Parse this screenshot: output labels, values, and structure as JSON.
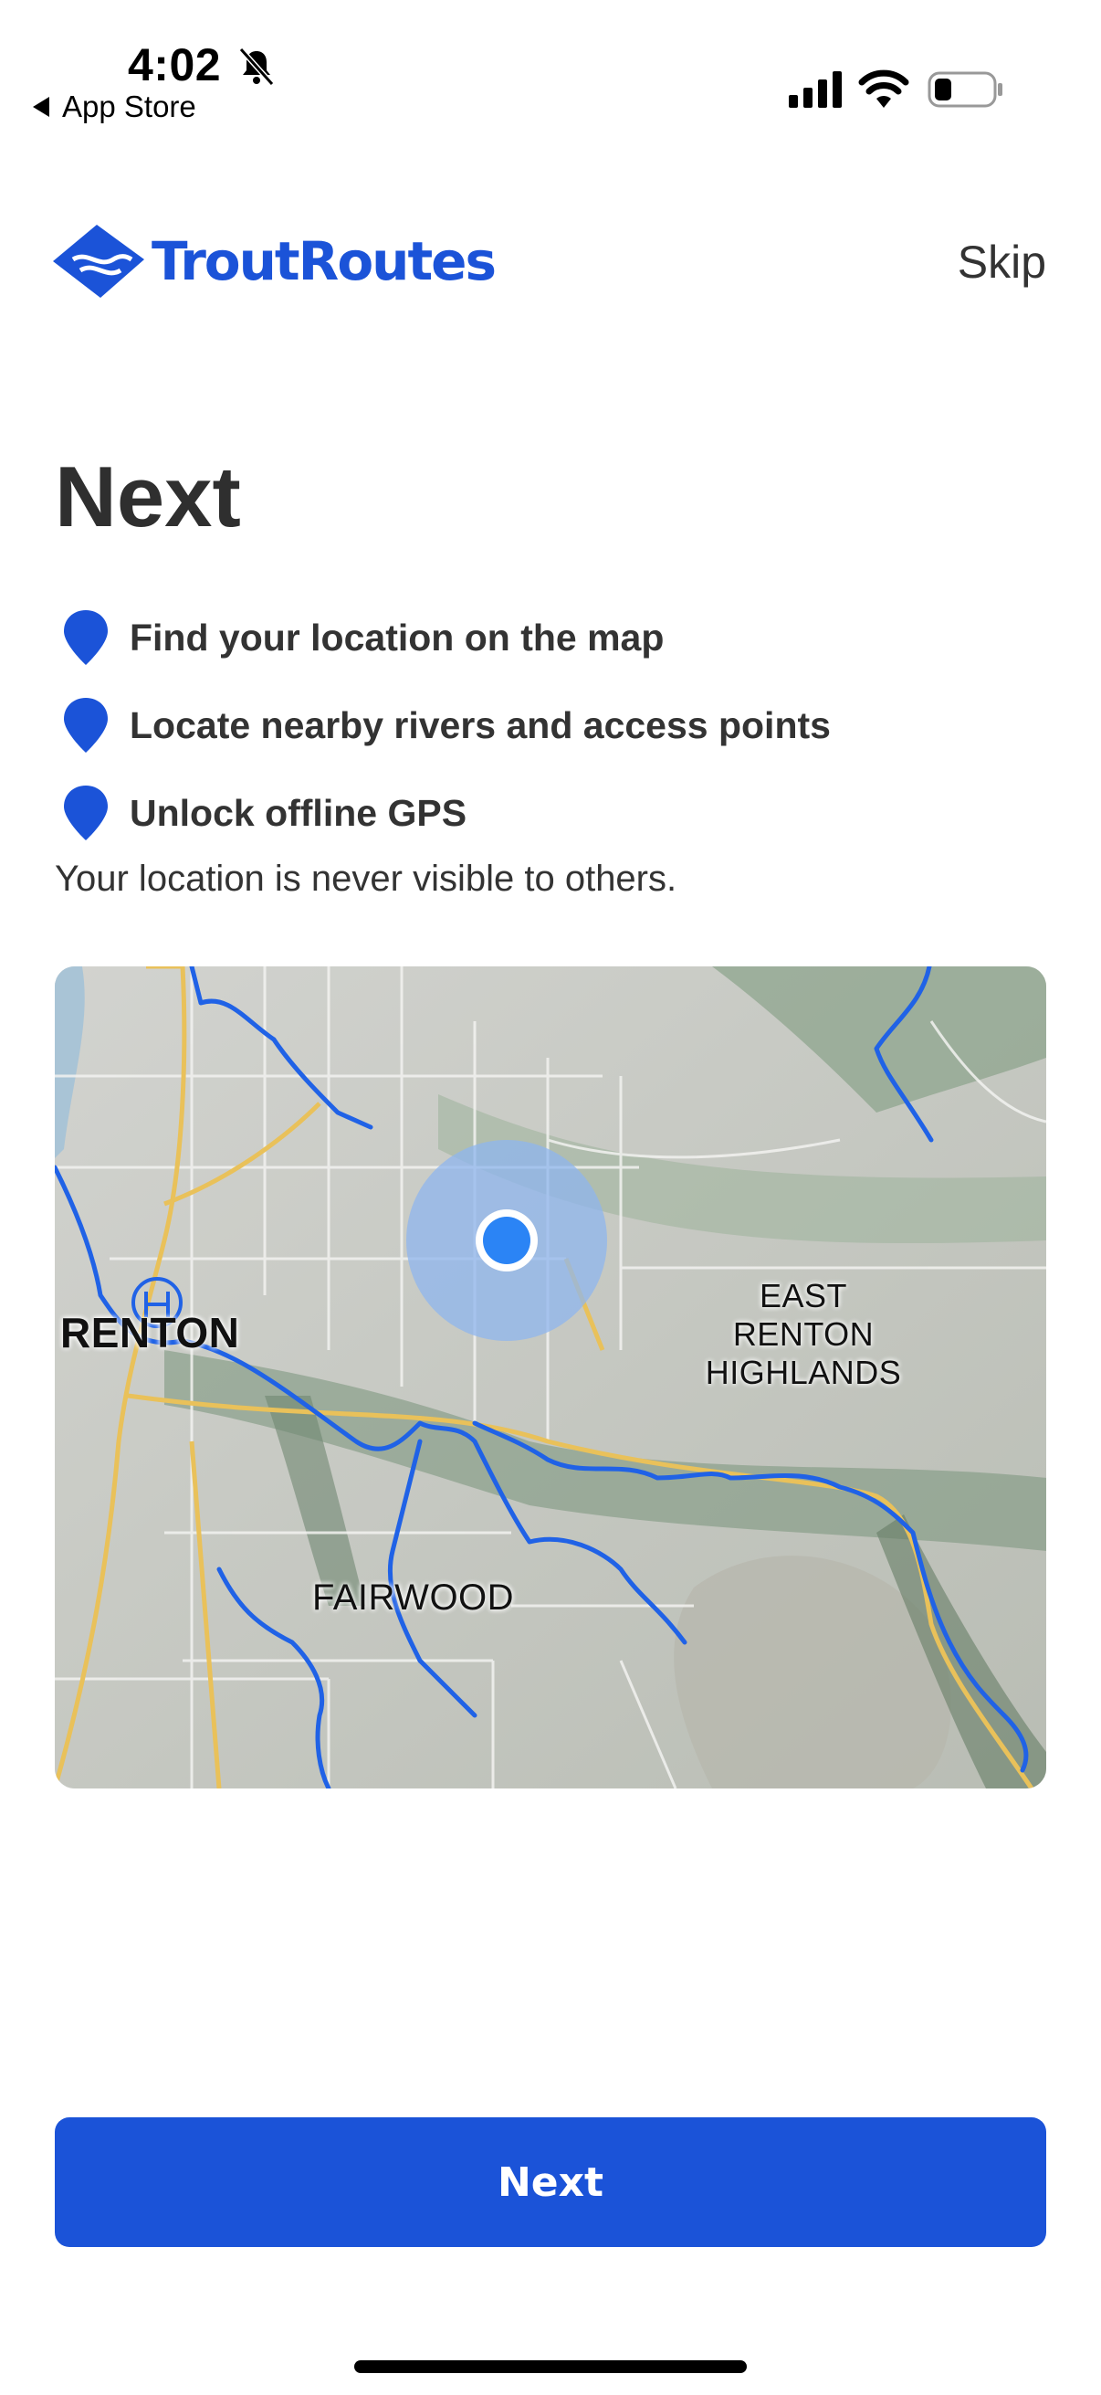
{
  "status_bar": {
    "time": "4:02",
    "back_label": "App Store"
  },
  "header": {
    "brand_name": "TroutRoutes",
    "skip_label": "Skip",
    "brand_color": "#1b53d8"
  },
  "main": {
    "title": "Next",
    "features": [
      {
        "icon": "location-pin-icon",
        "label": "Find your location on the map"
      },
      {
        "icon": "location-pin-icon",
        "label": "Locate nearby rivers and access points"
      },
      {
        "icon": "location-pin-icon",
        "label": "Unlock offline GPS"
      }
    ],
    "privacy_note": "Your location is never visible to others."
  },
  "map": {
    "labels": {
      "renton": "RENTON",
      "east_renton_line1": "EAST RENTON",
      "east_renton_line2": "HIGHLANDS",
      "fairwood": "FAIRWOOD"
    },
    "river_color": "#2062e6",
    "road_color": "#e9c15a"
  },
  "footer": {
    "next_label": "Next"
  }
}
